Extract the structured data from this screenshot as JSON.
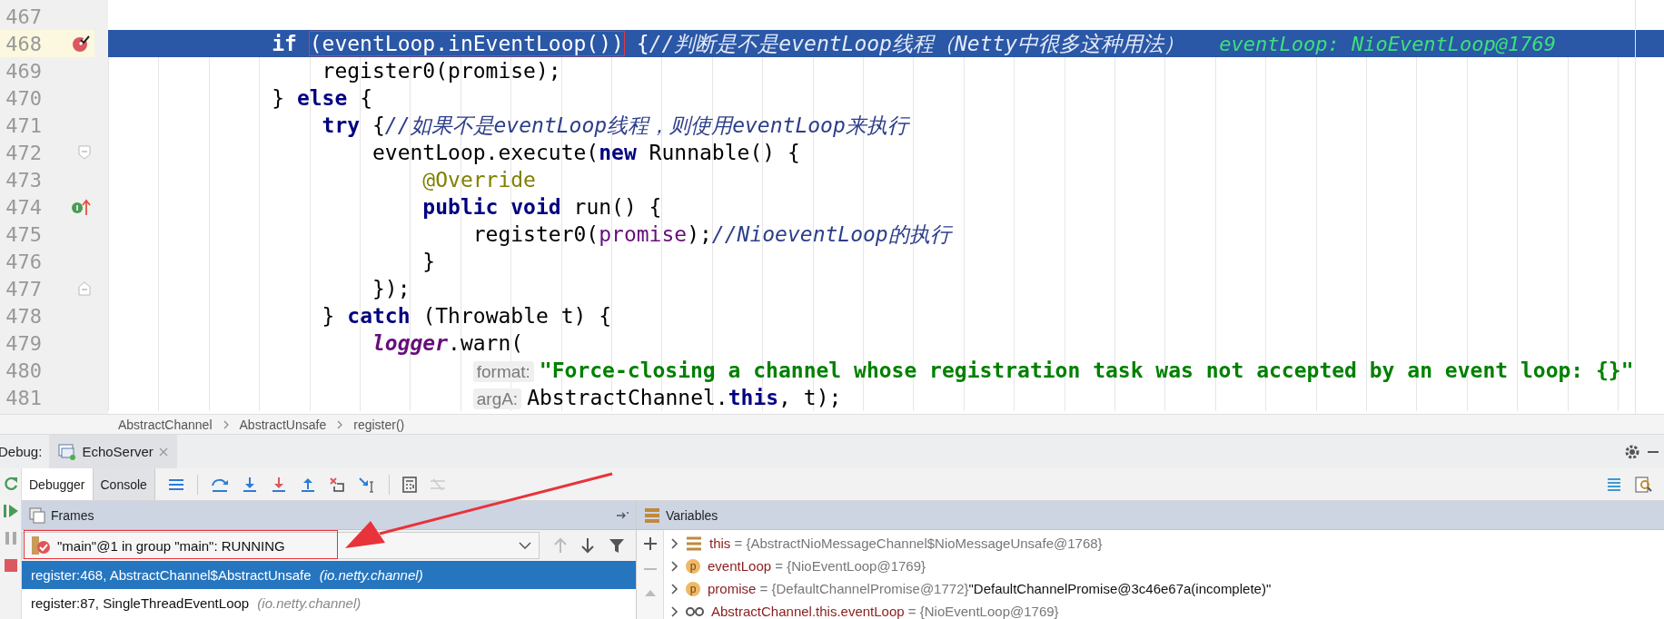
{
  "editor": {
    "lines": [
      {
        "number": "467",
        "current": false
      },
      {
        "number": "468",
        "current": true,
        "gutter_icon": {
          "kind": "breakpoint"
        },
        "tokens": [
          {
            "kind": "keyword",
            "text": "            if"
          },
          {
            "kind": "boxed",
            "text": " (eventLoop.inEventLoop())"
          },
          {
            "kind": "plain",
            "text": " {"
          },
          {
            "kind": "comment",
            "text": "//判断是不是eventLoop线程（Netty中很多这种用法）"
          }
        ],
        "inline_value": "eventLoop: NioEventLoop@1769"
      },
      {
        "number": "469",
        "current": false,
        "tokens": [
          {
            "kind": "plain",
            "text": "                register0(promise);"
          }
        ]
      },
      {
        "number": "470",
        "current": false,
        "tokens": [
          {
            "kind": "plain",
            "text": "            }"
          },
          {
            "kind": "keyword",
            "text": " else"
          },
          {
            "kind": "plain",
            "text": " {"
          }
        ]
      },
      {
        "number": "471",
        "current": false,
        "tokens": [
          {
            "kind": "keyword",
            "text": "                try"
          },
          {
            "kind": "plain",
            "text": " {"
          },
          {
            "kind": "comment",
            "text": "//如果不是eventLoop线程，则使用eventLoop来执行"
          }
        ]
      },
      {
        "number": "472",
        "current": false,
        "gutter_icon": {
          "kind": "fold-start"
        },
        "tokens": [
          {
            "kind": "plain",
            "text": "                    eventLoop.execute("
          },
          {
            "kind": "keyword",
            "text": "new"
          },
          {
            "kind": "plain",
            "text": " Runnable() {"
          }
        ]
      },
      {
        "number": "473",
        "current": false,
        "tokens": [
          {
            "kind": "annotation",
            "text": "                        @Override"
          }
        ]
      },
      {
        "number": "474",
        "current": false,
        "gutter_icon": {
          "kind": "implements"
        },
        "tokens": [
          {
            "kind": "keyword",
            "text": "                        public void"
          },
          {
            "kind": "plain",
            "text": " run() {"
          }
        ]
      },
      {
        "number": "475",
        "current": false,
        "tokens": [
          {
            "kind": "plain",
            "text": "                            register0("
          },
          {
            "kind": "field",
            "text": "promise"
          },
          {
            "kind": "plain",
            "text": ");"
          },
          {
            "kind": "comment",
            "text": "//NioeventLoop的执行"
          }
        ]
      },
      {
        "number": "476",
        "current": false,
        "tokens": [
          {
            "kind": "plain",
            "text": "                        }"
          }
        ]
      },
      {
        "number": "477",
        "current": false,
        "gutter_icon": {
          "kind": "fold-end"
        },
        "tokens": [
          {
            "kind": "plain",
            "text": "                    });"
          }
        ]
      },
      {
        "number": "478",
        "current": false,
        "tokens": [
          {
            "kind": "plain",
            "text": "                }"
          },
          {
            "kind": "keyword",
            "text": " catch"
          },
          {
            "kind": "plain",
            "text": " (Throwable t) {"
          }
        ]
      },
      {
        "number": "479",
        "current": false,
        "tokens": [
          {
            "kind": "static",
            "text": "                    logger"
          },
          {
            "kind": "plain",
            "text": ".warn("
          }
        ]
      },
      {
        "number": "480",
        "current": false,
        "tokens": [
          {
            "kind": "hint",
            "text": "                            format:"
          },
          {
            "kind": "string",
            "text": "\"Force-closing a channel whose registration task was not accepted by an event loop: {}\""
          }
        ]
      },
      {
        "number": "481",
        "current": false,
        "tokens": [
          {
            "kind": "hint",
            "text": "                            argA:"
          },
          {
            "kind": "plain",
            "text": "AbstractChannel."
          },
          {
            "kind": "keyword",
            "text": "this"
          },
          {
            "kind": "plain",
            "text": ", t);"
          }
        ]
      }
    ]
  },
  "breadcrumb": [
    "AbstractChannel",
    "AbstractUnsafe",
    "register()"
  ],
  "debug": {
    "label": "Debug:",
    "session_tab": "EchoServer",
    "tabs": [
      {
        "label": "Debugger",
        "selected": true
      },
      {
        "label": "Console",
        "selected": false
      }
    ],
    "frames": {
      "title": "Frames",
      "thread": "\"main\"@1 in group \"main\": RUNNING",
      "items": [
        {
          "method": "register:468, AbstractChannel$AbstractUnsafe",
          "package": "(io.netty.channel)",
          "selected": true
        },
        {
          "method": "register:87, SingleThreadEventLoop",
          "package": "(io.netty.channel)",
          "selected": false
        }
      ]
    },
    "variables": {
      "title": "Variables",
      "items": [
        {
          "kind": "object",
          "name": "this",
          "operator": "=",
          "value": "{AbstractNioMessageChannel$NioMessageUnsafe@1768}"
        },
        {
          "kind": "param",
          "badge": "p",
          "name": "eventLoop",
          "operator": "=",
          "value": "{NioEventLoop@1769}"
        },
        {
          "kind": "param",
          "badge": "p",
          "name": "promise",
          "operator": "=",
          "value": "{DefaultChannelPromise@1772}",
          "text": "\"DefaultChannelPromise@3c46e67a(incomplete)\""
        },
        {
          "kind": "outer",
          "name": "AbstractChannel.this.eventLoop",
          "operator": "=",
          "value": "{NioEventLoop@1769}"
        }
      ]
    }
  }
}
